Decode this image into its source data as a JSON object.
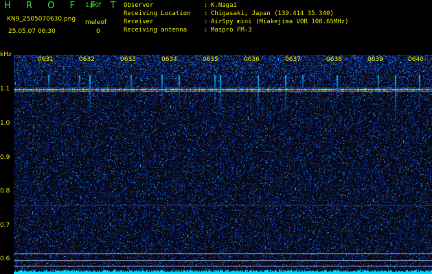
{
  "header": {
    "brand": "H R O F F T",
    "version": "1.00f",
    "filename": "KN9_2505070630.png",
    "meleof_label": "meleof",
    "meleof_value": "0",
    "timestamp": "25.05.07 06:30"
  },
  "info": [
    {
      "label": "Observer",
      "value": "K.Nagai"
    },
    {
      "label": "Receiving Location",
      "value": "Chigasaki, Japan (139.414 35.340)"
    },
    {
      "label": "Receiver",
      "value": "AirSpy mini (Miakejima VOR 108.65MHz)"
    },
    {
      "label": "Receiving antenna",
      "value": "Maspro FM-3"
    }
  ],
  "axis": {
    "y_unit": "kHz",
    "y_ticks": [
      "1.1",
      "1.0",
      "0.9",
      "0.8",
      "0.7",
      "0.6"
    ],
    "x_ticks": [
      "0631",
      "0632",
      "0633",
      "0634",
      "0635",
      "0636",
      "0637",
      "0638",
      "0639",
      "0640"
    ]
  },
  "colors": {
    "background": "#000000",
    "label_yellow": "#e8e800",
    "brand_green": "#33e033",
    "noise_blue": "#1a3cff",
    "carrier_red": "#ff2a2a",
    "baseline_cyan": "#00e8ff"
  }
}
